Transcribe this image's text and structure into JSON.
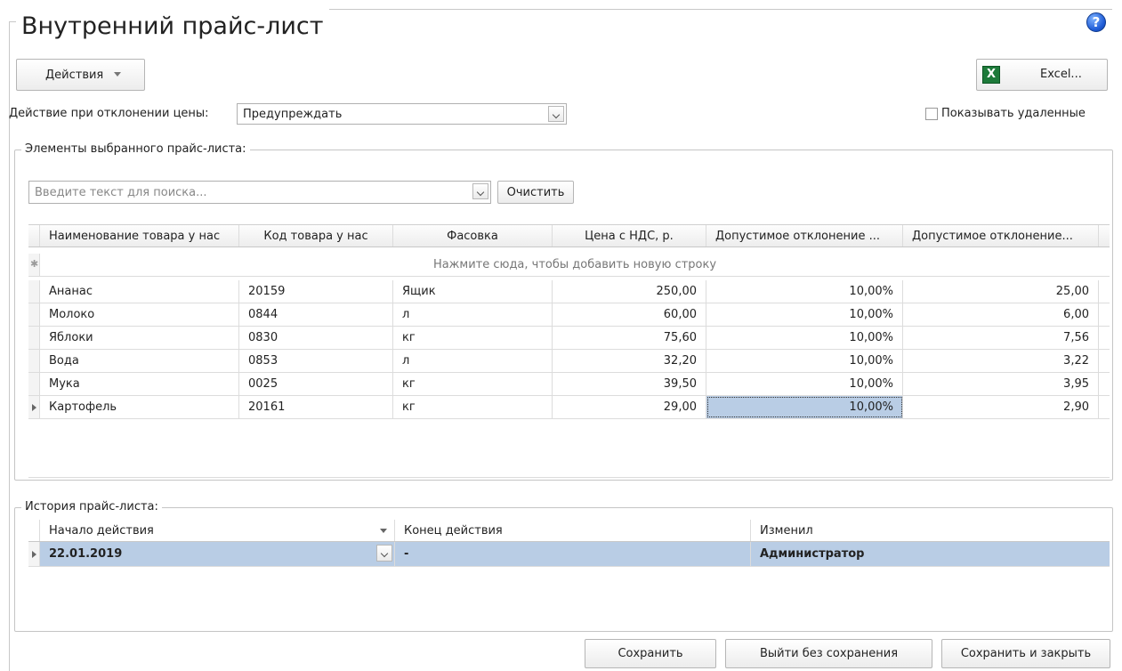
{
  "window": {
    "title": "Внутренний прайс-лист",
    "help_icon": "question-icon"
  },
  "toolbar": {
    "actions_label": "Действия",
    "excel_label": "Excel..."
  },
  "price_deviation": {
    "label": "Действие при отклонении цены:",
    "value": "Предупреждать"
  },
  "show_deleted": {
    "label": "Показывать удаленные",
    "checked": false
  },
  "elements": {
    "legend": "Элементы выбранного прайс-листа:",
    "search_placeholder": "Введите текст для поиска...",
    "clear_label": "Очистить",
    "columns": [
      "Наименование товара у нас",
      "Код товара у нас",
      "Фасовка",
      "Цена с НДС, р.",
      "Допустимое отклонение ...",
      "Допустимое отклонение..."
    ],
    "new_row_hint": "Нажмите сюда, чтобы добавить новую строку",
    "rows": [
      [
        "Ананас",
        "20159",
        "Ящик",
        "250,00",
        "10,00%",
        "25,00"
      ],
      [
        "Молоко",
        "0844",
        "л",
        "60,00",
        "10,00%",
        "6,00"
      ],
      [
        "Яблоки",
        "0830",
        "кг",
        "75,60",
        "10,00%",
        "7,56"
      ],
      [
        "Вода",
        "0853",
        "л",
        "32,20",
        "10,00%",
        "3,22"
      ],
      [
        "Мука",
        "0025",
        "кг",
        "39,50",
        "10,00%",
        "3,95"
      ],
      [
        "Картофель",
        "20161",
        "кг",
        "29,00",
        "10,00%",
        "2,90"
      ]
    ]
  },
  "history": {
    "legend": "История прайс-листа:",
    "columns": [
      "Начало действия",
      "Конец действия",
      "Изменил"
    ],
    "rows": [
      [
        "22.01.2019",
        "-",
        "Администратор"
      ]
    ]
  },
  "footer": {
    "save_label": "Сохранить",
    "exit_label": "Выйти без сохранения",
    "save_close_label": "Сохранить и закрыть"
  }
}
